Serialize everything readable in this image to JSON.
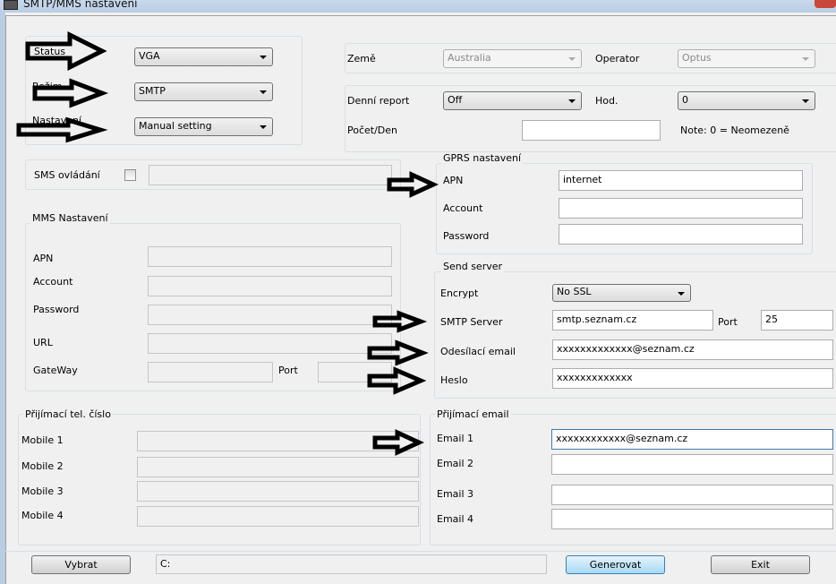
{
  "window": {
    "title": "SMTP/MMS nastavení"
  },
  "mode_group": {
    "status": {
      "label": "Status",
      "value": "VGA"
    },
    "rezim": {
      "label": "Režim",
      "value": "SMTP"
    },
    "nastaveni": {
      "label": "Nastavení",
      "value": "Manual setting"
    }
  },
  "region": {
    "country_label": "Země",
    "country_value": "Australia",
    "operator_label": "Operator",
    "operator_value": "Optus"
  },
  "report": {
    "daily_label": "Denní report",
    "daily_value": "Off",
    "hour_label": "Hod.",
    "hour_value": "0",
    "count_label": "Počet/Den",
    "count_value": "",
    "note": "Note: 0 = Neomezeně"
  },
  "sms": {
    "label": "SMS ovládání",
    "checked": false,
    "value": ""
  },
  "mms": {
    "title": "MMS Nastavení",
    "apn_label": "APN",
    "account_label": "Account",
    "password_label": "Password",
    "url_label": "URL",
    "gateway_label": "GateWay",
    "port_label": "Port"
  },
  "gprs": {
    "title": "GPRS nastavení",
    "apn_label": "APN",
    "apn_value": "internet",
    "account_label": "Account",
    "account_value": "",
    "password_label": "Password",
    "password_value": ""
  },
  "send_server": {
    "title": "Send server",
    "encrypt_label": "Encrypt",
    "encrypt_value": "No SSL",
    "smtp_label": "SMTP Server",
    "smtp_value": "smtp.seznam.cz",
    "port_label": "Port",
    "port_value": "25",
    "sender_label": "Odesílací email",
    "sender_value": "xxxxxxxxxxxxx@seznam.cz",
    "password_label": "Heslo",
    "password_value": "xxxxxxxxxxxxx"
  },
  "phones": {
    "title": "Přijímací tel. číslo",
    "items": [
      {
        "label": "Mobile 1"
      },
      {
        "label": "Mobile 2"
      },
      {
        "label": "Mobile 3"
      },
      {
        "label": "Mobile 4"
      }
    ]
  },
  "emails": {
    "title": "Přijímací email",
    "items": [
      {
        "label": "Email 1",
        "value": "xxxxxxxxxxxx@seznam.cz"
      },
      {
        "label": "Email 2",
        "value": ""
      },
      {
        "label": "Email 3",
        "value": ""
      },
      {
        "label": "Email 4",
        "value": ""
      }
    ]
  },
  "footer": {
    "select_label": "Vybrat",
    "path_value": "C:",
    "generate_label": "Generovat",
    "exit_label": "Exit"
  },
  "colors": {
    "annotation_arrow": "#000000",
    "default_button": "#a7d9f5",
    "close_button": "#c9463d"
  }
}
